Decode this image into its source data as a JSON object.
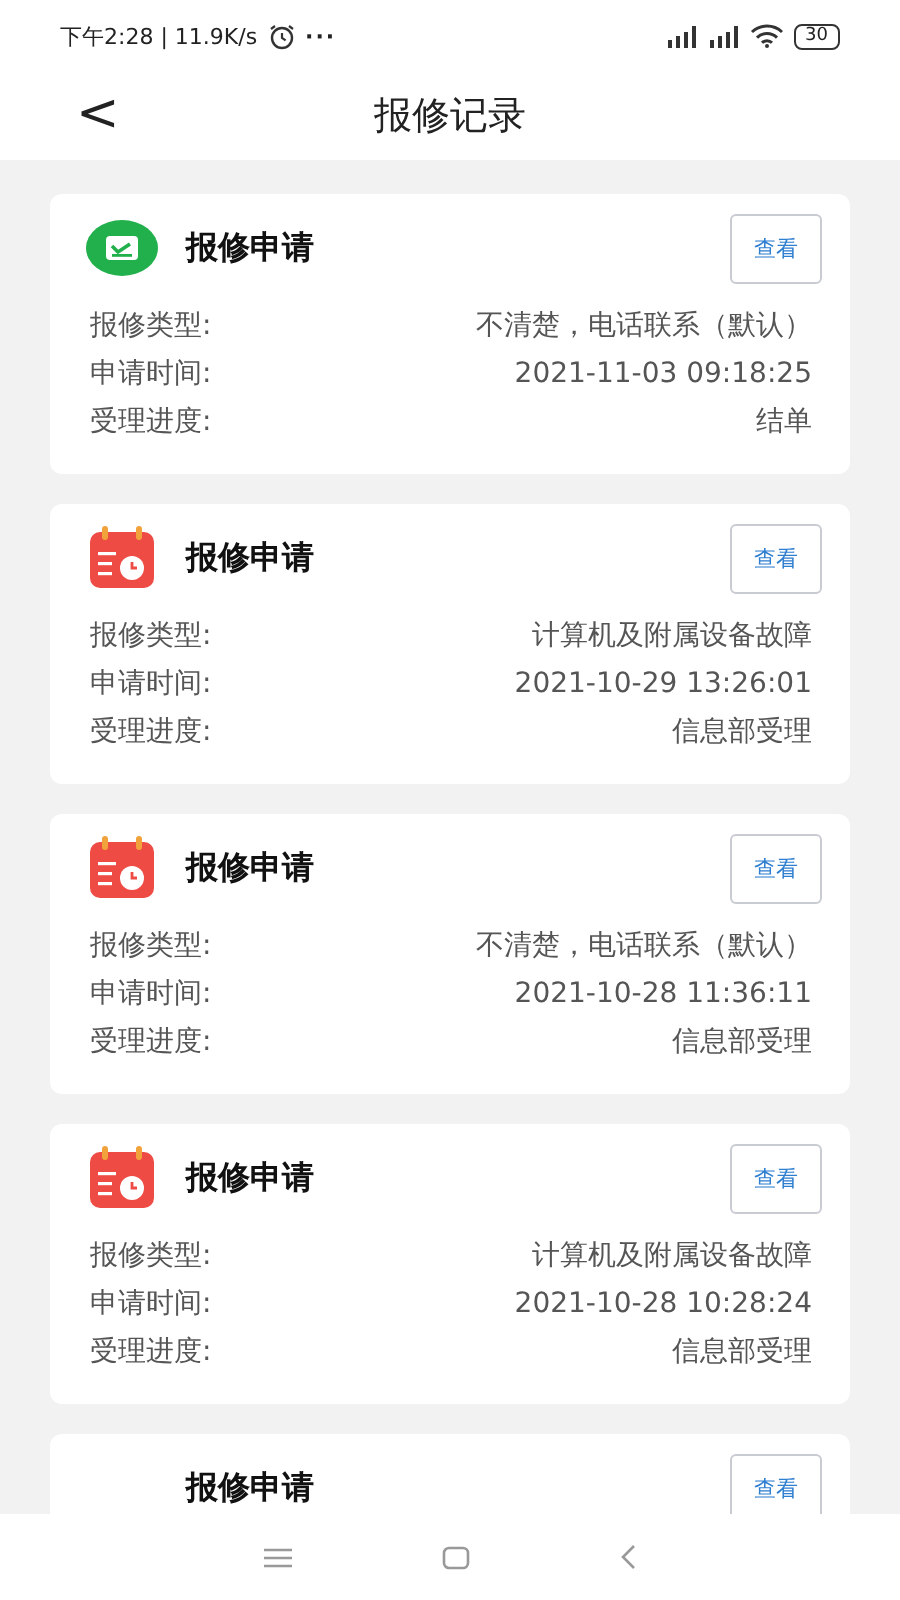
{
  "status_bar": {
    "time": "下午2:28 | 11.9K/s",
    "more": "···",
    "battery": "30"
  },
  "header": {
    "back": "<",
    "title": "报修记录"
  },
  "records": [
    {
      "kind": "done",
      "title": "报修申请",
      "button": "查看",
      "rows": [
        {
          "label": "报修类型:",
          "value": "不清楚，电话联系（默认）"
        },
        {
          "label": "申请时间:",
          "value": "2021-11-03 09:18:25"
        },
        {
          "label": "受理进度:",
          "value": "结单"
        }
      ]
    },
    {
      "kind": "calendar",
      "title": "报修申请",
      "button": "查看",
      "rows": [
        {
          "label": "报修类型:",
          "value": "计算机及附属设备故障"
        },
        {
          "label": "申请时间:",
          "value": "2021-10-29 13:26:01"
        },
        {
          "label": "受理进度:",
          "value": "信息部受理"
        }
      ]
    },
    {
      "kind": "calendar",
      "title": "报修申请",
      "button": "查看",
      "rows": [
        {
          "label": "报修类型:",
          "value": "不清楚，电话联系（默认）"
        },
        {
          "label": "申请时间:",
          "value": "2021-10-28 11:36:11"
        },
        {
          "label": "受理进度:",
          "value": "信息部受理"
        }
      ]
    },
    {
      "kind": "calendar",
      "title": "报修申请",
      "button": "查看",
      "rows": [
        {
          "label": "报修类型:",
          "value": "计算机及附属设备故障"
        },
        {
          "label": "申请时间:",
          "value": "2021-10-28 10:28:24"
        },
        {
          "label": "受理进度:",
          "value": "信息部受理"
        }
      ]
    },
    {
      "kind": "none",
      "title": "报修申请",
      "button": "查看"
    }
  ]
}
